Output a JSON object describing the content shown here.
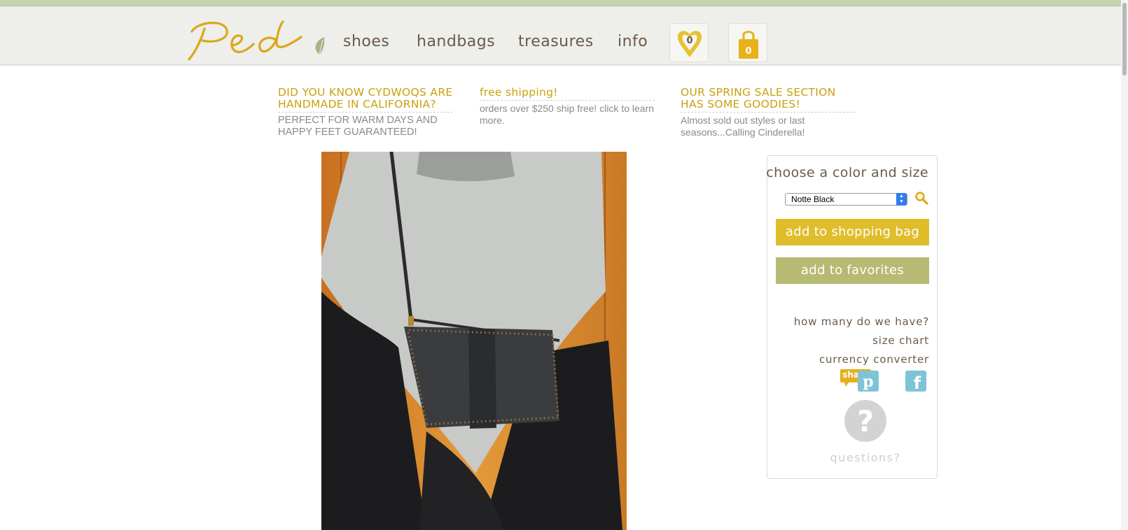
{
  "colors": {
    "accent_gold": "#c9a10f",
    "button_gold": "#dfbd2b",
    "button_green": "#b7ba73",
    "nav_text": "#6b5a4a",
    "header_bg": "#eeeeea",
    "top_strip": "#c7d3ad"
  },
  "header": {
    "logo_text": "Ped",
    "nav": [
      {
        "label": "shoes"
      },
      {
        "label": "handbags"
      },
      {
        "label": "treasures"
      },
      {
        "label": "info"
      }
    ],
    "favorites_count": "0",
    "bag_count": "0"
  },
  "promos": [
    {
      "title": "DID YOU KNOW CYDWOQS ARE HANDMADE IN CALIFORNIA?",
      "text": "PERFECT FOR WARM DAYS AND HAPPY FEET GUARANTEED!"
    },
    {
      "title": "free shipping!",
      "text": "orders over $250 ship free! click to learn more."
    },
    {
      "title": "OUR SPRING SALE SECTION HAS SOME GOODIES!",
      "text": "Almost sold out styles or last seasons...Calling Cinderella!"
    }
  ],
  "product_panel": {
    "title": "choose a color and size",
    "selected_color": "Notte Black",
    "add_to_bag_label": "add to shopping bag",
    "add_to_favorites_label": "add to favorites",
    "links": [
      {
        "label": "how many do we have?"
      },
      {
        "label": "size chart"
      },
      {
        "label": "currency converter"
      }
    ],
    "share_label": "share",
    "questions_label": "questions?"
  },
  "icons": {
    "leaf": "leaf-icon",
    "favorites": "heart-icon",
    "bag": "shopping-bag-icon",
    "zoom": "magnifier-icon",
    "share": "share-icon",
    "pinterest": "pinterest-icon",
    "facebook": "facebook-icon",
    "question": "question-icon"
  }
}
